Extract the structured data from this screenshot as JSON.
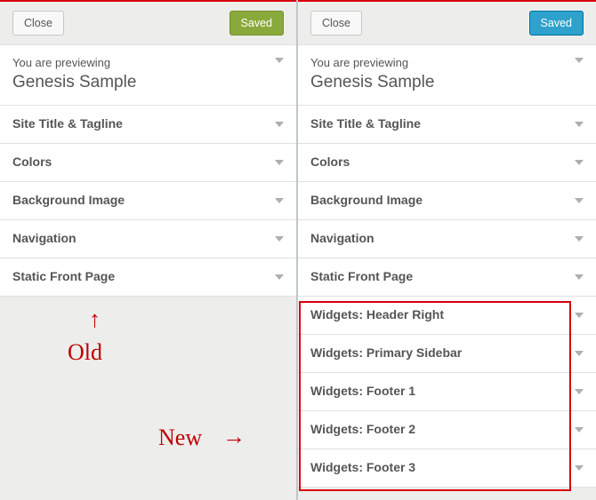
{
  "left": {
    "close_label": "Close",
    "saved_label": "Saved",
    "preview_label": "You are previewing",
    "preview_title": "Genesis Sample",
    "panels": [
      "Site Title & Tagline",
      "Colors",
      "Background Image",
      "Navigation",
      "Static Front Page"
    ]
  },
  "right": {
    "close_label": "Close",
    "saved_label": "Saved",
    "preview_label": "You are previewing",
    "preview_title": "Genesis Sample",
    "panels": [
      "Site Title & Tagline",
      "Colors",
      "Background Image",
      "Navigation",
      "Static Front Page",
      "Widgets: Header Right",
      "Widgets: Primary Sidebar",
      "Widgets: Footer 1",
      "Widgets: Footer 2",
      "Widgets: Footer 3"
    ]
  },
  "annotations": {
    "old_label": "Old",
    "new_label": "New"
  }
}
